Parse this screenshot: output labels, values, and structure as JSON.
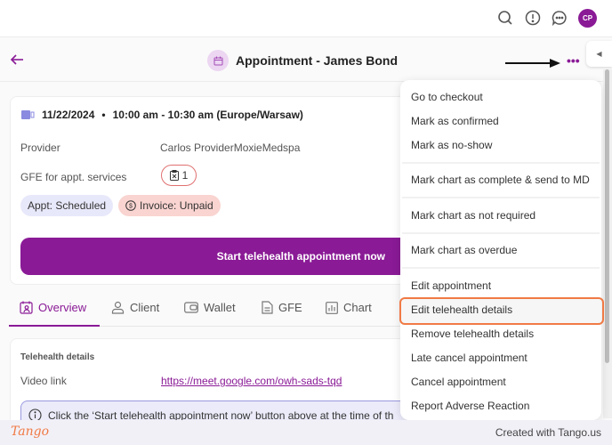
{
  "topbar": {
    "icons": [
      "search-icon",
      "alert-icon",
      "chat-icon"
    ],
    "avatar_initials": "CP"
  },
  "header": {
    "back_icon": "arrow-left-icon",
    "title_icon": "calendar-icon",
    "title": "Appointment - James Bond",
    "more_label": "•••"
  },
  "appointment": {
    "date": "11/22/2024",
    "separator": "•",
    "time": "10:00 am - 10:30 am (Europe/Warsaw)",
    "provider_label": "Provider",
    "provider_value": "Carlos ProviderMoxieMedspa",
    "gfe_label": "GFE for appt. services",
    "gfe_count": "1",
    "status_badge": "Appt: Scheduled",
    "invoice_badge": "Invoice: Unpaid",
    "start_button": "Start telehealth appointment now"
  },
  "tabs": [
    {
      "label": "Overview",
      "icon": "calendar-user-icon",
      "active": true
    },
    {
      "label": "Client",
      "icon": "user-icon",
      "active": false
    },
    {
      "label": "Wallet",
      "icon": "wallet-icon",
      "active": false
    },
    {
      "label": "GFE",
      "icon": "document-icon",
      "active": false
    },
    {
      "label": "Chart",
      "icon": "chart-icon",
      "active": false
    }
  ],
  "telehealth": {
    "section_title": "Telehealth details",
    "video_label": "Video link",
    "video_link": "https://meet.google.com/owh-sads-tqd",
    "info_text": "Click the ‘Start telehealth appointment now’ button above at the time of th"
  },
  "menu": {
    "items": [
      "Go to checkout",
      "Mark as confirmed",
      "Mark as no-show",
      "Mark chart as complete & send to MD",
      "Mark chart as not required",
      "Mark chart as overdue",
      "Edit appointment",
      "Edit telehealth details",
      "Remove telehealth details",
      "Late cancel appointment",
      "Cancel appointment",
      "Report Adverse Reaction"
    ],
    "highlighted": "Edit telehealth details"
  },
  "footer": {
    "logo": "Tango",
    "credit": "Created with Tango.us"
  },
  "colors": {
    "brand": "#8a1a96",
    "highlight": "#f07a45",
    "invoice_bg": "#f9d4d0",
    "status_bg": "#e8e8fb"
  }
}
